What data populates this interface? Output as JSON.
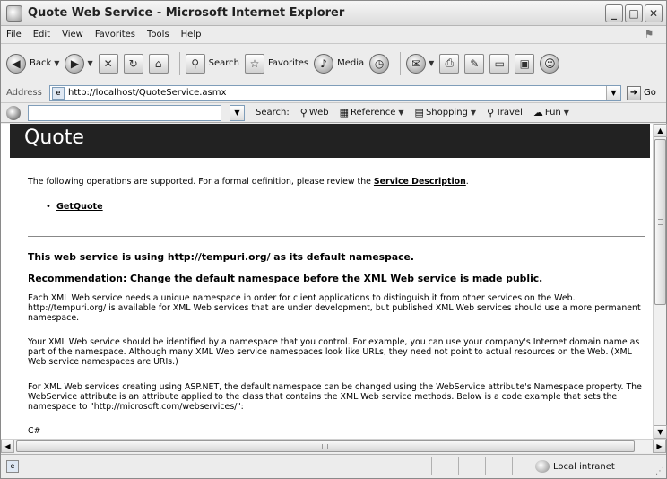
{
  "window": {
    "title": "Quote Web Service - Microsoft Internet Explorer",
    "minimize": "_",
    "maximize": "□",
    "close": "✕"
  },
  "menu": {
    "items": [
      "File",
      "Edit",
      "View",
      "Favorites",
      "Tools",
      "Help"
    ]
  },
  "toolbar": {
    "back_label": "Back",
    "search_label": "Search",
    "favorites_label": "Favorites",
    "media_label": "Media"
  },
  "address": {
    "label": "Address",
    "url": "http://localhost/QuoteService.asmx",
    "go_label": "Go"
  },
  "searchbar": {
    "label": "Search:",
    "web": "Web",
    "reference": "Reference",
    "shopping": "Shopping",
    "travel": "Travel",
    "fun": "Fun"
  },
  "page": {
    "heading": "Quote",
    "intro_text": "The following operations are supported. For a formal definition, please review the ",
    "service_description_link": "Service Description",
    "intro_end": ".",
    "operations": [
      "GetQuote"
    ],
    "namespace_line": "This web service is using http://tempuri.org/ as its default namespace.",
    "recommendation_line": "Recommendation: Change the default namespace before the XML Web service is made public.",
    "para1": "Each XML Web service needs a unique namespace in order for client applications to distinguish it from other services on the Web. http://tempuri.org/ is available for XML Web services that are under development, but published XML Web services should use a more permanent namespace.",
    "para2": "Your XML Web service should be identified by a namespace that you control. For example, you can use your company's Internet domain name as part of the namespace. Although many XML Web service namespaces look like URLs, they need not point to actual resources on the Web. (XML Web service namespaces are URIs.)",
    "para3": "For XML Web services creating using ASP.NET, the default namespace can be changed using the WebService attribute's Namespace property. The WebService attribute is an attribute applied to the class that contains the XML Web service methods. Below is a code example that sets the namespace to \"http://microsoft.com/webservices/\":",
    "code_lang": "C#"
  },
  "status": {
    "zone": "Local intranet"
  }
}
